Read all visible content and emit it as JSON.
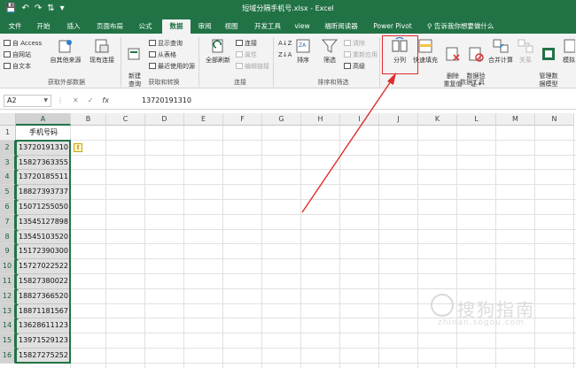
{
  "window": {
    "title": "短域分隔手机号.xlsx - Excel"
  },
  "tabs": [
    {
      "label": "文件",
      "active": false
    },
    {
      "label": "开始",
      "active": false
    },
    {
      "label": "插入",
      "active": false
    },
    {
      "label": "页面布局",
      "active": false
    },
    {
      "label": "公式",
      "active": false
    },
    {
      "label": "数据",
      "active": true
    },
    {
      "label": "审阅",
      "active": false
    },
    {
      "label": "视图",
      "active": false
    },
    {
      "label": "开发工具",
      "active": false
    },
    {
      "label": "view",
      "active": false
    },
    {
      "label": "福昕阅读器",
      "active": false
    },
    {
      "label": "Power Pivot",
      "active": false
    }
  ],
  "tell_me": "告诉我你想要做什么",
  "ribbon": {
    "get_external": {
      "access": "自 Access",
      "web": "自网站",
      "text": "自文本",
      "other": "自其他来源",
      "existing": "现有连接",
      "group": "获取外部数据"
    },
    "get_transform": {
      "new_query": "新建\n查询",
      "show_query": "显示查询",
      "from_table": "从表格",
      "recent": "最近使用的源",
      "group": "获取和转换"
    },
    "connections": {
      "refresh_all": "全部刷新",
      "connections": "连接",
      "properties": "属性",
      "edit_links": "编辑链接",
      "group": "连接"
    },
    "sort_filter": {
      "sort": "排序",
      "filter": "筛选",
      "clear": "清除",
      "reapply": "重新应用",
      "advanced": "高级",
      "group": "排序和筛选"
    },
    "data_tools": {
      "split": "分列",
      "flash_fill": "快速填充",
      "remove_dup": "删除\n重复值",
      "validation": "数据验\n证 ▾",
      "consolidate": "合并计算",
      "relations": "关系",
      "manage_model": "管理数\n据模型",
      "group": "数据工具"
    },
    "forecast": {
      "what_if": "模拟"
    }
  },
  "formula_bar": {
    "name_box": "A2",
    "formula": "13720191310"
  },
  "columns": [
    "A",
    "B",
    "C",
    "D",
    "E",
    "F",
    "G",
    "H",
    "I",
    "J",
    "K",
    "L",
    "M",
    "N"
  ],
  "rows": [
    "1",
    "2",
    "3",
    "4",
    "5",
    "6",
    "7",
    "8",
    "9",
    "10",
    "11",
    "12",
    "13",
    "14",
    "15",
    "16"
  ],
  "sheet": {
    "header": "手机号码",
    "values": [
      "13720191310",
      "15827363355",
      "13720185511",
      "18827393737",
      "15071255050",
      "13545127898",
      "13545103520",
      "15172390300",
      "15727022522",
      "15827380022",
      "18827366520",
      "18871181567",
      "13628611123",
      "13971529123",
      "15827275252"
    ]
  },
  "watermark": {
    "cn": "搜狗指南",
    "en": "zhinan.sogou.com"
  },
  "colors": {
    "brand": "#217346",
    "highlight": "#e02c2c"
  }
}
